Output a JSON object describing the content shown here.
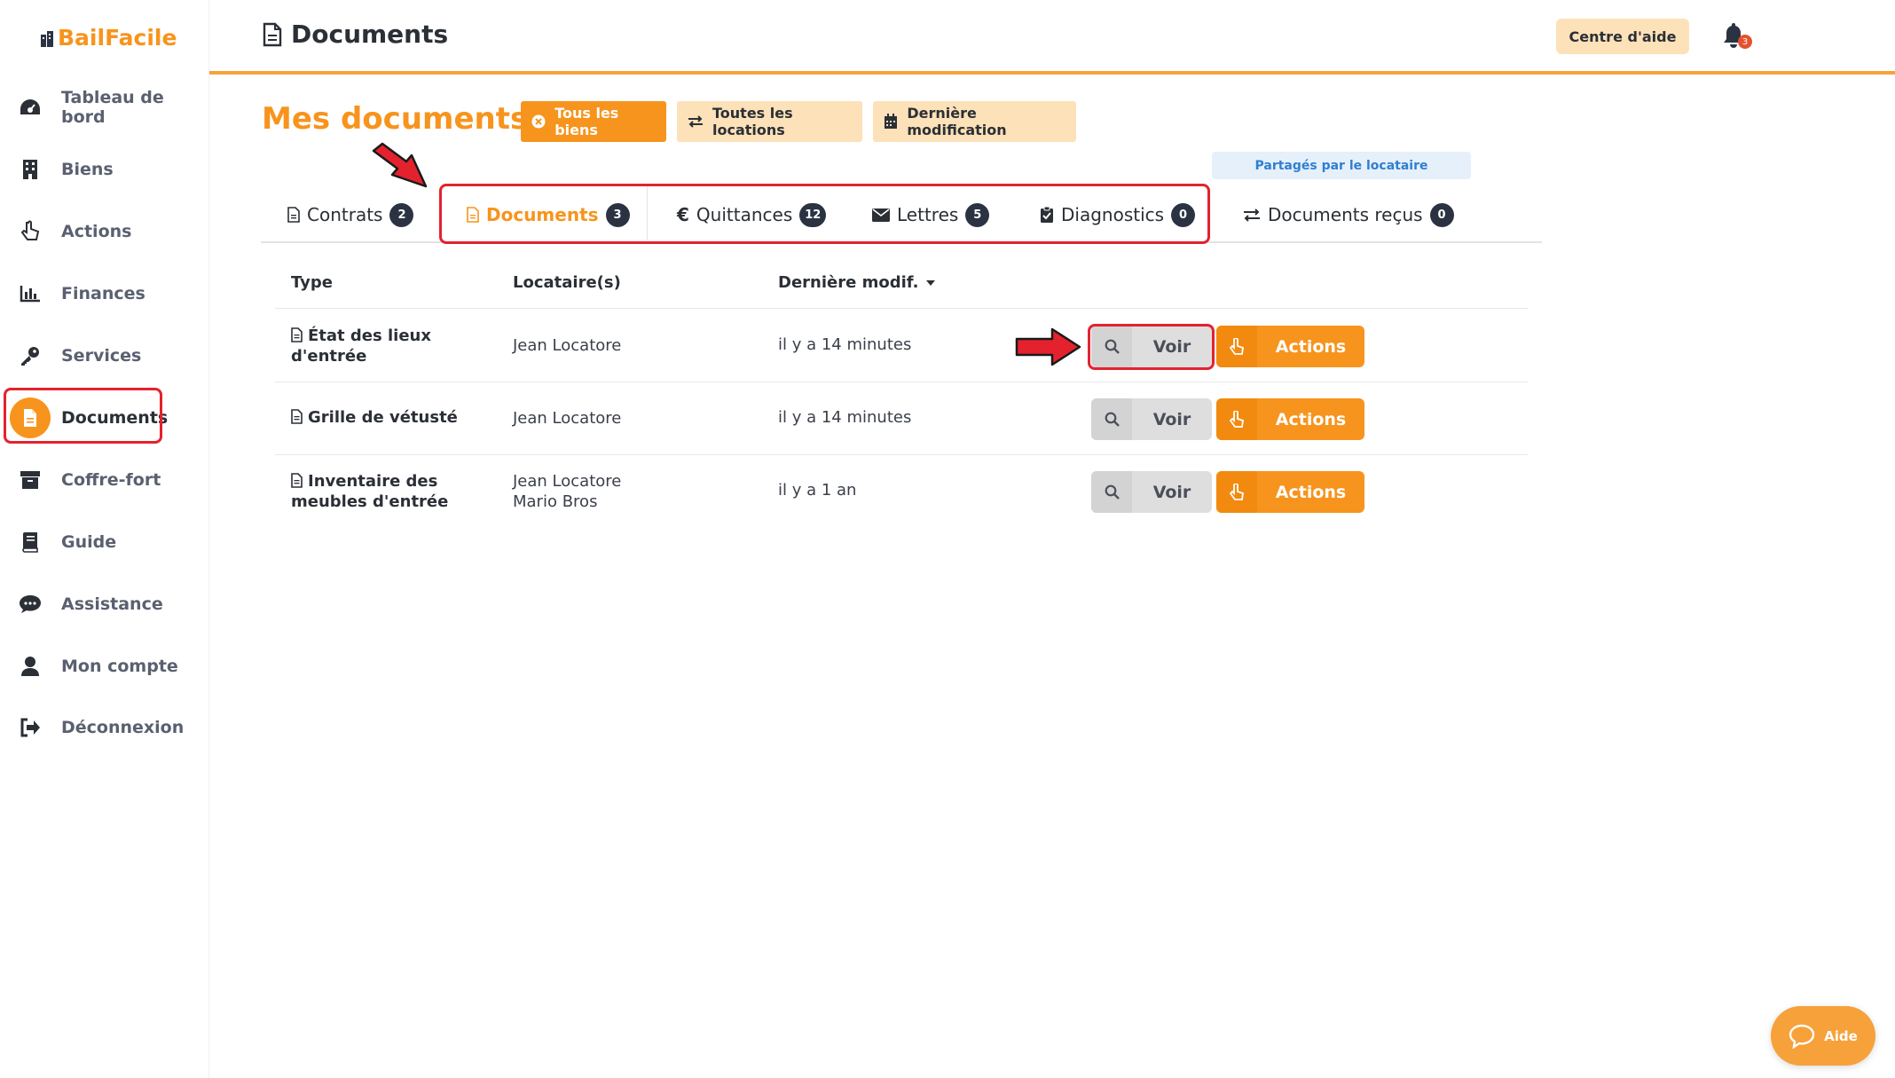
{
  "brand": {
    "name": "BailFacile"
  },
  "header": {
    "title": "Documents",
    "help_label": "Centre d'aide",
    "notifications_count": "3"
  },
  "sidebar": {
    "items": [
      {
        "label": "Tableau de bord",
        "icon": "dashboard-icon"
      },
      {
        "label": "Biens",
        "icon": "building-icon"
      },
      {
        "label": "Actions",
        "icon": "hand-pointer-icon"
      },
      {
        "label": "Finances",
        "icon": "bar-chart-icon"
      },
      {
        "label": "Services",
        "icon": "key-icon"
      },
      {
        "label": "Documents",
        "icon": "file-icon",
        "active": true
      },
      {
        "label": "Coffre-fort",
        "icon": "archive-icon"
      },
      {
        "label": "Guide",
        "icon": "book-icon"
      },
      {
        "label": "Assistance",
        "icon": "chat-icon"
      },
      {
        "label": "Mon compte",
        "icon": "user-icon"
      },
      {
        "label": "Déconnexion",
        "icon": "sign-out-icon"
      }
    ]
  },
  "main": {
    "title": "Mes documents",
    "filters": [
      {
        "label": "Tous les biens",
        "icon": "close-circle-icon",
        "active": true
      },
      {
        "label": "Toutes les locations",
        "icon": "exchange-icon"
      },
      {
        "label": "Dernière modification",
        "icon": "calendar-icon"
      }
    ],
    "shared_badge": "Partagés par le locataire",
    "tabs": [
      {
        "label": "Contrats",
        "count": "2"
      },
      {
        "label": "Documents",
        "count": "3",
        "active": true
      },
      {
        "label": "Quittances",
        "count": "12"
      },
      {
        "label": "Lettres",
        "count": "5"
      },
      {
        "label": "Diagnostics",
        "count": "0"
      },
      {
        "label": "Documents reçus",
        "count": "0"
      }
    ],
    "table": {
      "columns": [
        "Type",
        "Locataire(s)",
        "Dernière modif."
      ],
      "rows": [
        {
          "type_line1": "État des lieux",
          "type_line2": "d'entrée",
          "tenant1": "Jean Locatore",
          "tenant2": "",
          "date": "il y a 14 minutes"
        },
        {
          "type_line1": "Grille de vétusté",
          "type_line2": "",
          "tenant1": "Jean Locatore",
          "tenant2": "",
          "date": "il y a 14 minutes"
        },
        {
          "type_line1": "Inventaire des",
          "type_line2": "meubles d'entrée",
          "tenant1": "Jean Locatore",
          "tenant2": "Mario Bros",
          "date": "il y a 1 an"
        }
      ],
      "view_label": "Voir",
      "actions_label": "Actions"
    }
  },
  "help_widget": {
    "label": "Aide"
  },
  "colors": {
    "accent": "#f7941d",
    "annotation": "#e3222e",
    "badge_dark": "#2b3343"
  }
}
